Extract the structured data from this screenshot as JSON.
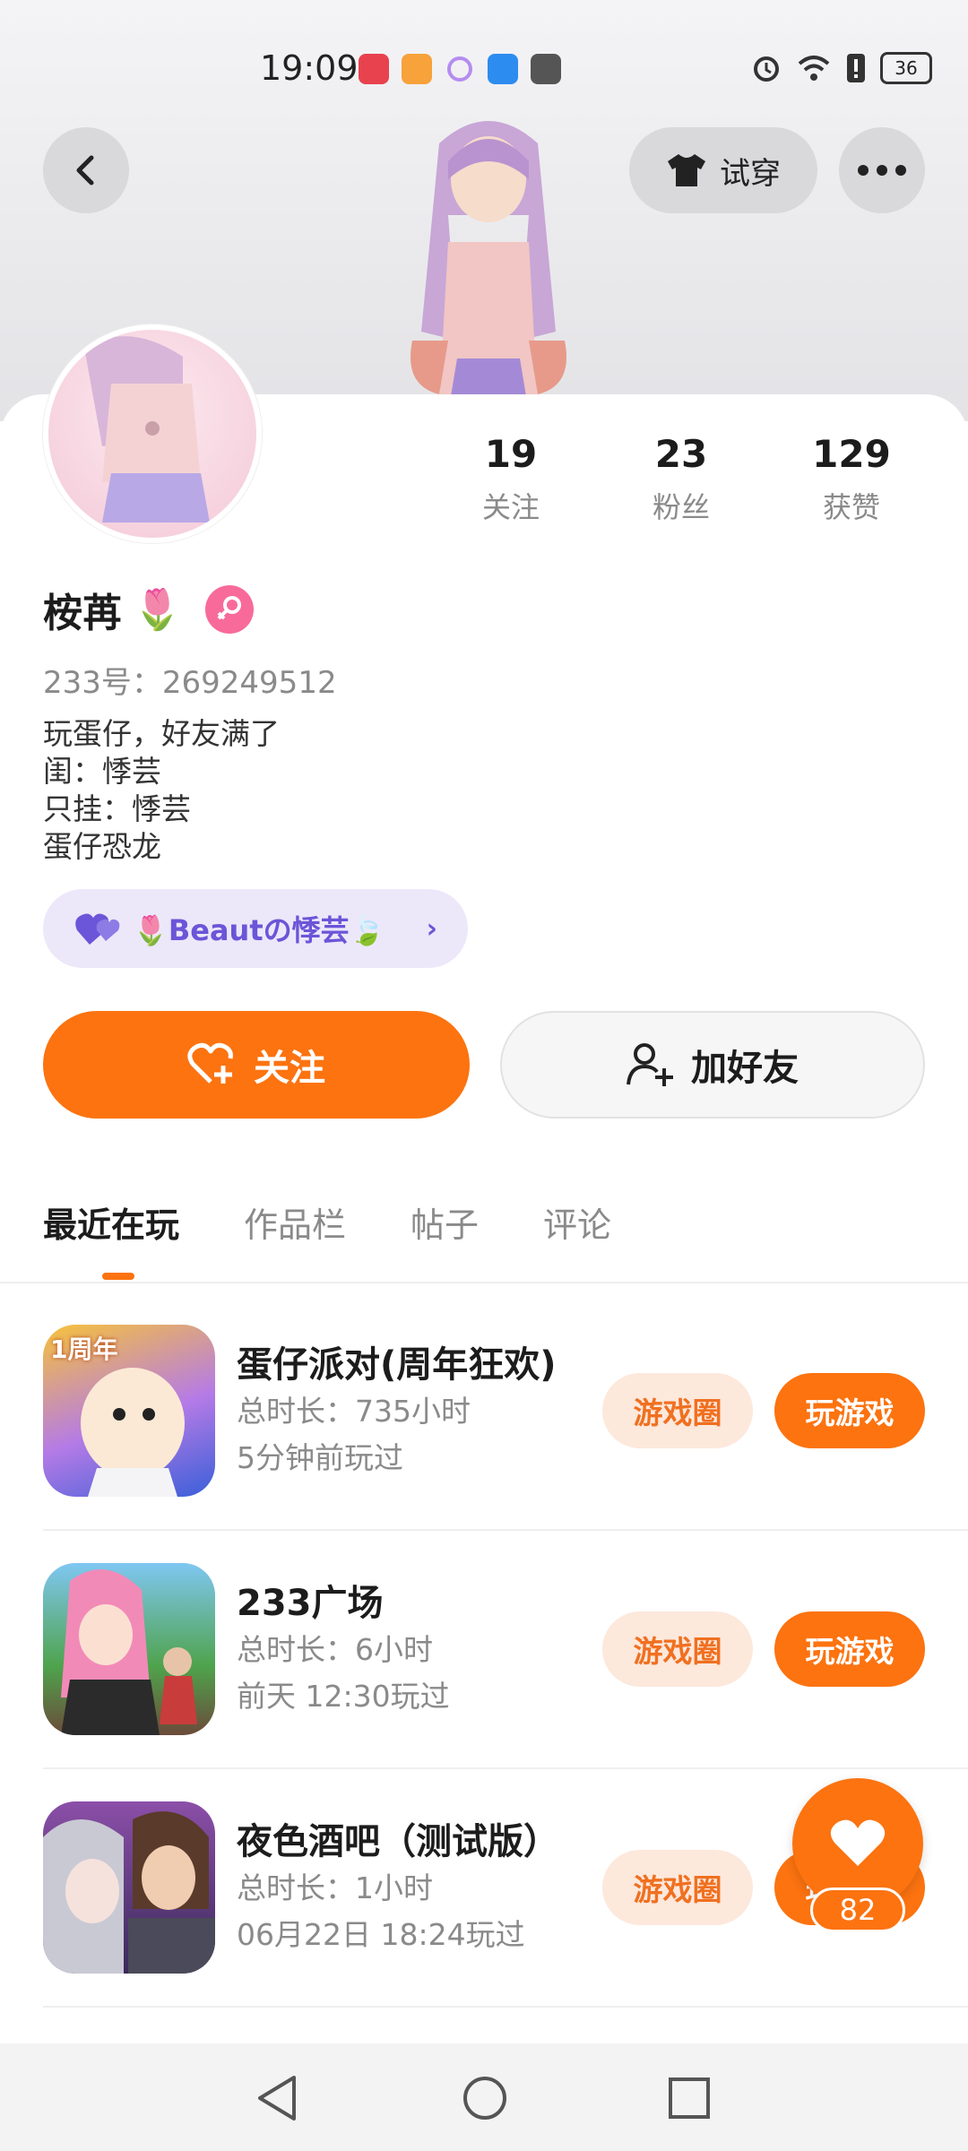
{
  "status_bar": {
    "time": "19:09",
    "battery": "36"
  },
  "header": {
    "try_on_label": "试穿"
  },
  "profile": {
    "stats": [
      {
        "value": "19",
        "label": "关注"
      },
      {
        "value": "23",
        "label": "粉丝"
      },
      {
        "value": "129",
        "label": "获赞"
      }
    ],
    "name": "桉苒",
    "name_emoji": "🌷",
    "uid": "233号：269249512",
    "bio_lines": [
      "玩蛋仔，好友满了",
      "闺：悸芸",
      "只挂：悸芸",
      "蛋仔恐龙"
    ],
    "relation_tag": "🌷Beautの悸芸🍃"
  },
  "actions": {
    "follow_label": "关注",
    "add_friend_label": "加好友"
  },
  "tabs": [
    {
      "label": "最近在玩",
      "active": true
    },
    {
      "label": "作品栏",
      "active": false
    },
    {
      "label": "帖子",
      "active": false
    },
    {
      "label": "评论",
      "active": false
    }
  ],
  "games": [
    {
      "title": "蛋仔派对(周年狂欢)",
      "duration": "总时长：735小时",
      "last_played": "5分钟前玩过",
      "icon_badge": "1周年",
      "circle_label": "游戏圈",
      "play_label": "玩游戏"
    },
    {
      "title": "233广场",
      "duration": "总时长：6小时",
      "last_played": "前天 12:30玩过",
      "circle_label": "游戏圈",
      "play_label": "玩游戏"
    },
    {
      "title": "夜色酒吧（测试版）",
      "duration": "总时长：1小时",
      "last_played": "06月22日 18:24玩过",
      "circle_label": "游戏圈",
      "play_label": "玩游戏"
    }
  ],
  "like_fab": {
    "count": "82"
  },
  "colors": {
    "accent": "#fc7310",
    "accent_light": "#fde8dc",
    "tag_purple": "#6b55d8",
    "tag_bg": "#ece8fa",
    "gender_pink": "#f86a9a"
  }
}
